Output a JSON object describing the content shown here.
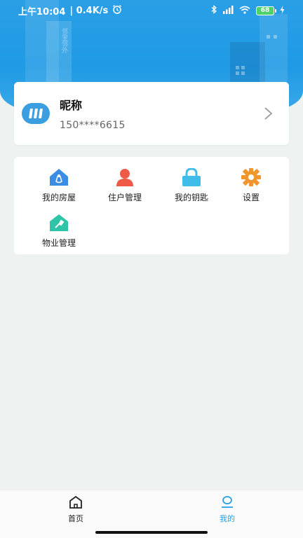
{
  "status_bar": {
    "time": "上午10:04",
    "network_speed": "| 0.4K/s",
    "battery": "68",
    "icons": [
      "alarm-icon",
      "bluetooth-icon",
      "signal-icon",
      "wifi-icon",
      "battery-icon",
      "charging-icon"
    ]
  },
  "hero_text": "邻里邻外",
  "profile": {
    "nickname": "昵称",
    "phone": "150****6615"
  },
  "menu": {
    "items": [
      {
        "label": "我的房屋",
        "icon": "house-icon",
        "color": "#3b8de3"
      },
      {
        "label": "住户管理",
        "icon": "user-icon",
        "color": "#ef5a47"
      },
      {
        "label": "我的钥匙",
        "icon": "lock-icon",
        "color": "#3fbde8"
      },
      {
        "label": "设置",
        "icon": "gear-icon",
        "color": "#f2962c"
      },
      {
        "label": "物业管理",
        "icon": "property-icon",
        "color": "#2fc3a8"
      }
    ]
  },
  "bottom_nav": {
    "tabs": [
      {
        "label": "首页",
        "icon": "home-icon",
        "active": false
      },
      {
        "label": "我的",
        "icon": "profile-icon",
        "active": true
      }
    ],
    "active_color": "#2a9fe6"
  }
}
